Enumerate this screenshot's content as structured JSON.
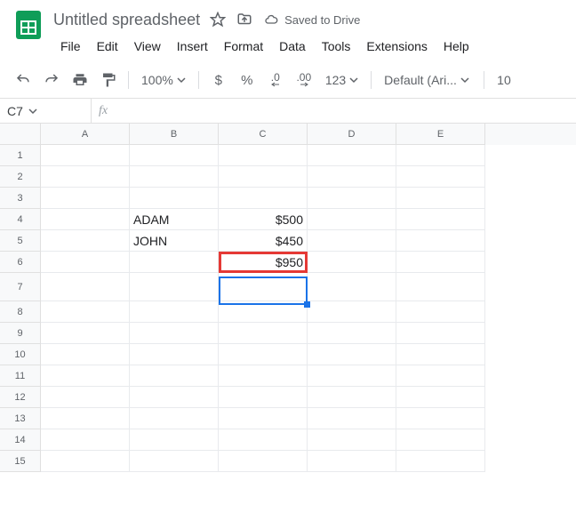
{
  "doc": {
    "title": "Untitled spreadsheet",
    "save_status": "Saved to Drive"
  },
  "menu": {
    "file": "File",
    "edit": "Edit",
    "view": "View",
    "insert": "Insert",
    "format": "Format",
    "data": "Data",
    "tools": "Tools",
    "extensions": "Extensions",
    "help": "Help"
  },
  "toolbar": {
    "zoom": "100%",
    "currency": "$",
    "percent": "%",
    "dec_dec": ".0",
    "inc_dec": ".00",
    "more_formats": "123",
    "font": "Default (Ari...",
    "font_size": "10"
  },
  "namebox": {
    "ref": "C7"
  },
  "formula": {
    "label": "fx",
    "value": ""
  },
  "columns": [
    "A",
    "B",
    "C",
    "D",
    "E"
  ],
  "rows": [
    "1",
    "2",
    "3",
    "4",
    "5",
    "6",
    "7",
    "8",
    "9",
    "10",
    "11",
    "12",
    "13",
    "14",
    "15"
  ],
  "data": {
    "B4": "ADAM",
    "C4": "$500",
    "B5": "JOHN",
    "C5": "$450",
    "C6": "$950"
  }
}
